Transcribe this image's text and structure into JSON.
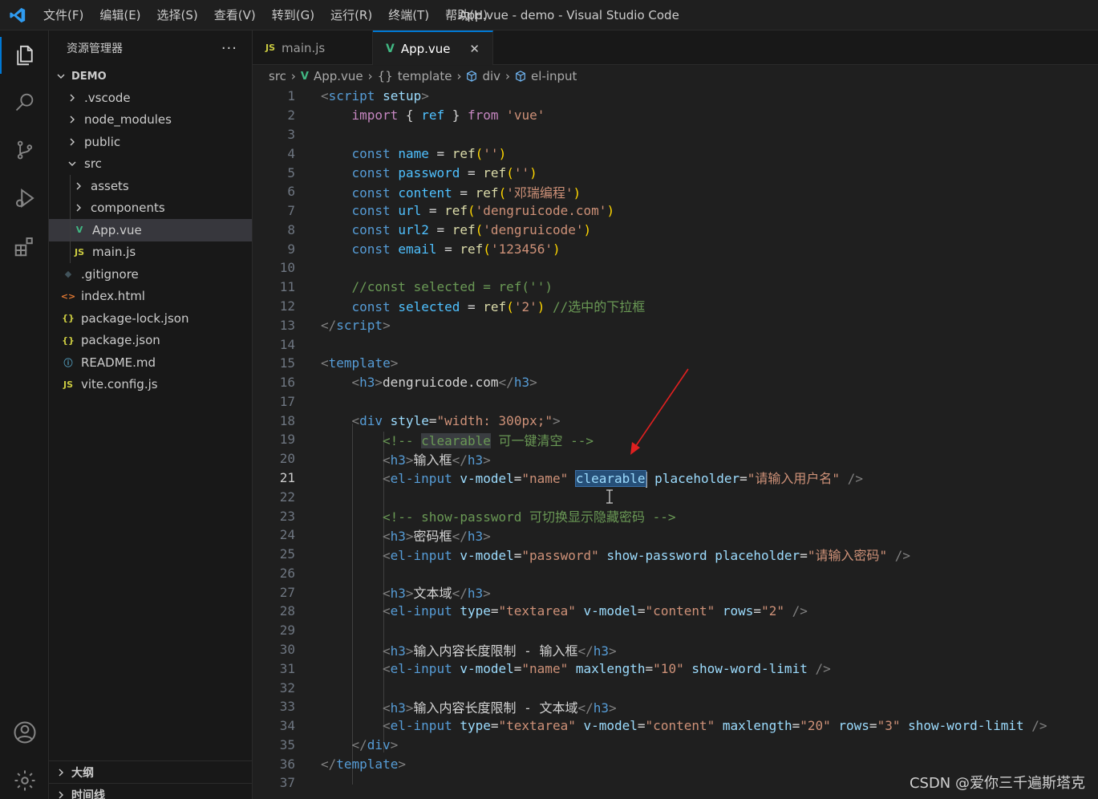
{
  "window": {
    "title": "App.vue - demo - Visual Studio Code"
  },
  "menu": [
    "文件(F)",
    "编辑(E)",
    "选择(S)",
    "查看(V)",
    "转到(G)",
    "运行(R)",
    "终端(T)",
    "帮助(H)"
  ],
  "sidebar": {
    "title": "资源管理器",
    "more": "···",
    "section": "DEMO",
    "items": [
      {
        "label": ".vscode",
        "type": "folder"
      },
      {
        "label": "node_modules",
        "type": "folder"
      },
      {
        "label": "public",
        "type": "folder"
      },
      {
        "label": "src",
        "type": "folder-open"
      },
      {
        "label": "assets",
        "type": "folder"
      },
      {
        "label": "components",
        "type": "folder"
      },
      {
        "label": "App.vue",
        "type": "vue"
      },
      {
        "label": "main.js",
        "type": "js"
      },
      {
        "label": ".gitignore",
        "type": "git"
      },
      {
        "label": "index.html",
        "type": "html"
      },
      {
        "label": "package-lock.json",
        "type": "json"
      },
      {
        "label": "package.json",
        "type": "json"
      },
      {
        "label": "README.md",
        "type": "info"
      },
      {
        "label": "vite.config.js",
        "type": "js"
      }
    ],
    "outline": "大纲",
    "timeline": "时间线"
  },
  "tabs": [
    {
      "label": "main.js",
      "icon": "JS"
    },
    {
      "label": "App.vue",
      "icon": "V",
      "close": "✕"
    }
  ],
  "breadcrumb": {
    "src": "src",
    "file": "App.vue",
    "template": "template",
    "div": "div",
    "input": "el-input",
    "braces": "{}"
  },
  "lines": [
    "1",
    "2",
    "3",
    "4",
    "5",
    "6",
    "7",
    "8",
    "9",
    "10",
    "11",
    "12",
    "13",
    "14",
    "15",
    "16",
    "17",
    "18",
    "19",
    "20",
    "21",
    "22",
    "23",
    "24",
    "25",
    "26",
    "27",
    "28",
    "29",
    "30",
    "31",
    "32",
    "33",
    "34",
    "35",
    "36",
    "37"
  ],
  "code": {
    "l1": [
      "<",
      "script",
      " setup",
      ">"
    ],
    "l2": [
      "import",
      " { ",
      "ref",
      " } ",
      "from",
      " 'vue'"
    ],
    "l4": [
      "const",
      " ",
      "name",
      " = ",
      "ref",
      "(",
      "''",
      ")"
    ],
    "l5": [
      "const",
      " ",
      "password",
      " = ",
      "ref",
      "(",
      "''",
      ")"
    ],
    "l6": [
      "const",
      " ",
      "content",
      " = ",
      "ref",
      "(",
      "'邓瑞编程'",
      ")"
    ],
    "l7": [
      "const",
      " ",
      "url",
      " = ",
      "ref",
      "(",
      "'dengruicode.com'",
      ")"
    ],
    "l8": [
      "const",
      " ",
      "url2",
      " = ",
      "ref",
      "(",
      "'dengruicode'",
      ")"
    ],
    "l9": [
      "const",
      " ",
      "email",
      " = ",
      "ref",
      "(",
      "'123456'",
      ")"
    ],
    "l11": "//const selected = ref('')",
    "l12": [
      "const",
      " ",
      "selected",
      " = ",
      "ref",
      "(",
      "'2'",
      ")",
      " //选中的下拉框"
    ],
    "l13": [
      "</",
      "script",
      ">"
    ],
    "l15": [
      "<",
      "template",
      ">"
    ],
    "l16": [
      "<",
      "h3",
      ">",
      "dengruicode.com",
      "</",
      "h3",
      ">"
    ],
    "l18": [
      "<",
      "div",
      " style",
      "=",
      "\"width: 300px;\"",
      ">"
    ],
    "l19": [
      "<!-- ",
      "clearable",
      " 可一键清空 -->"
    ],
    "l20": [
      "<",
      "h3",
      ">",
      "输入框",
      "</",
      "h3",
      ">"
    ],
    "l21": [
      "<",
      "el-input",
      " v-model",
      "=",
      "\"name\"",
      " ",
      "clearable",
      " placeholder",
      "=",
      "\"请输入用户名\"",
      " />"
    ],
    "l23": "<!-- show-password 可切换显示隐藏密码 -->",
    "l24": [
      "<",
      "h3",
      ">",
      "密码框",
      "</",
      "h3",
      ">"
    ],
    "l25": [
      "<",
      "el-input",
      " v-model",
      "=",
      "\"password\"",
      " show-password",
      " placeholder",
      "=",
      "\"请输入密码\"",
      " />"
    ],
    "l27": [
      "<",
      "h3",
      ">",
      "文本域",
      "</",
      "h3",
      ">"
    ],
    "l28": [
      "<",
      "el-input",
      " type",
      "=",
      "\"textarea\"",
      " v-model",
      "=",
      "\"content\"",
      " rows",
      "=",
      "\"2\"",
      " />"
    ],
    "l30": [
      "<",
      "h3",
      ">",
      "输入内容长度限制 - 输入框",
      "</",
      "h3",
      ">"
    ],
    "l31": [
      "<",
      "el-input",
      " v-model",
      "=",
      "\"name\"",
      " maxlength",
      "=",
      "\"10\"",
      " show-word-limit",
      " />"
    ],
    "l33": [
      "<",
      "h3",
      ">",
      "输入内容长度限制 - 文本域",
      "</",
      "h3",
      ">"
    ],
    "l34": [
      "<",
      "el-input",
      " type",
      "=",
      "\"textarea\"",
      " v-model",
      "=",
      "\"content\"",
      " maxlength",
      "=",
      "\"20\"",
      " rows",
      "=",
      "\"3\"",
      " show-word-limit",
      " />"
    ],
    "l35": [
      "</",
      "div",
      ">"
    ],
    "l36": [
      "</",
      "template",
      ">"
    ]
  },
  "watermark": "CSDN @爱你三千遍斯塔克",
  "colors": {
    "accent": "#0078d4",
    "selection": "#264f78"
  }
}
